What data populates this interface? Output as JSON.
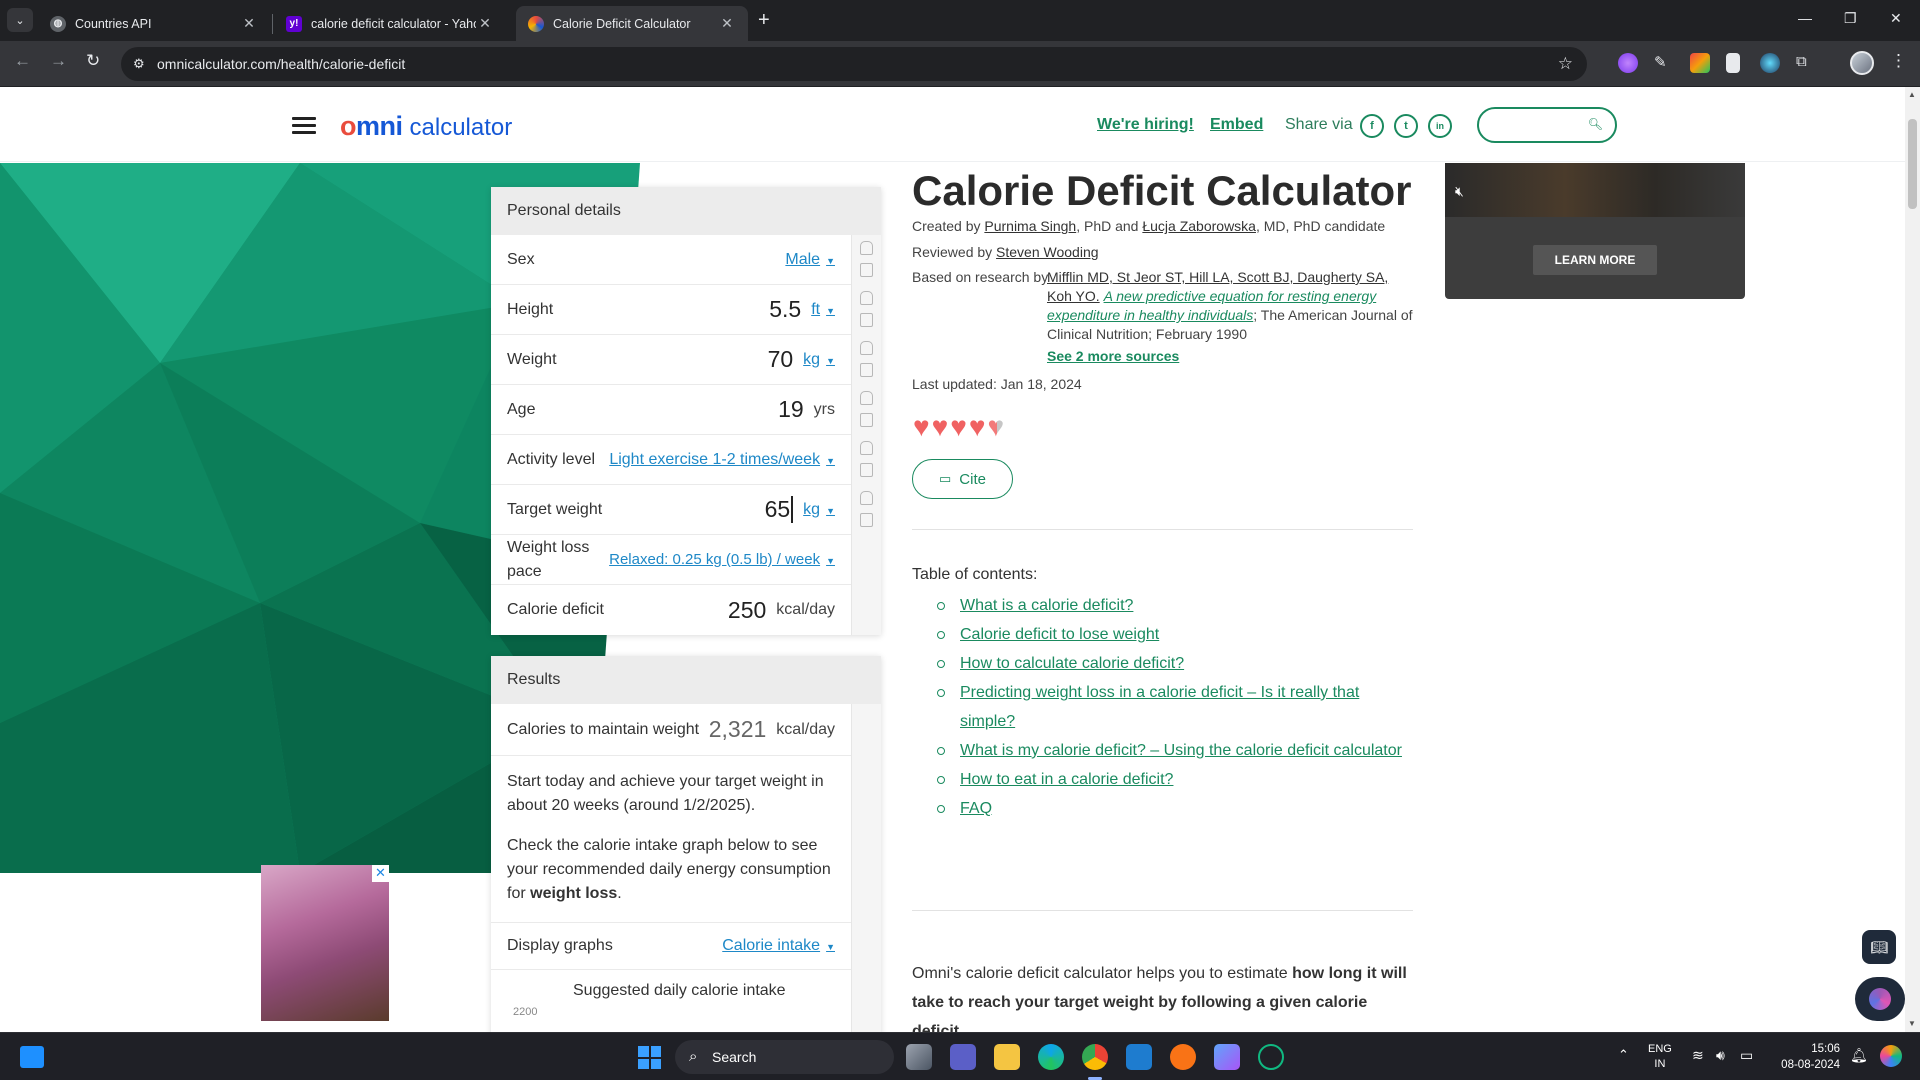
{
  "browser": {
    "tabs": [
      {
        "title": "Countries API",
        "active": false
      },
      {
        "title": "calorie deficit calculator - Yahoo",
        "active": false
      },
      {
        "title": "Calorie Deficit Calculator",
        "active": true
      }
    ],
    "new_tab": "+",
    "url": "omnicalculator.com/health/calorie-deficit"
  },
  "site": {
    "logo_omni": "mni",
    "logo_omni_o": "o",
    "logo_calc": "calculator",
    "hiring": "We're hiring!",
    "embed": "Embed",
    "share_via": "Share via",
    "social": {
      "facebook": "f",
      "twitter": "t",
      "linkedin": "in"
    }
  },
  "calculator": {
    "personal_header": "Personal details",
    "sex": {
      "label": "Sex",
      "value": "Male"
    },
    "height": {
      "label": "Height",
      "value": "5.5",
      "unit": "ft"
    },
    "weight": {
      "label": "Weight",
      "value": "70",
      "unit": "kg"
    },
    "age": {
      "label": "Age",
      "value": "19",
      "unit": "yrs"
    },
    "activity": {
      "label": "Activity level",
      "value": "Light exercise 1-2 times/week"
    },
    "target_weight": {
      "label": "Target weight",
      "value": "65",
      "unit": "kg"
    },
    "pace": {
      "label_line1": "Weight loss",
      "label_line2": "pace",
      "value": "Relaxed: 0.25 kg (0.5 lb) / week"
    },
    "deficit": {
      "label": "Calorie deficit",
      "value": "250",
      "unit": "kcal/day"
    },
    "results_header": "Results",
    "maintain": {
      "label": "Calories to maintain weight",
      "value": "2,321",
      "unit": "kcal/day"
    },
    "result_text_1": "Start today and achieve your target weight in about 20 weeks (around 1/2/2025).",
    "result_text_2_pre": "Check the calorie intake graph below to see your recommended daily energy consumption for",
    "result_text_2_bold": "weight loss",
    "result_text_2_post": ".",
    "display_graphs": {
      "label": "Display graphs",
      "value": "Calorie intake"
    },
    "graph_title": "Suggested daily calorie intake",
    "graph_tick": "2200"
  },
  "article": {
    "title": "Calorie Deficit Calculator",
    "created_prefix": "Created by",
    "author1": "Purnima Singh",
    "author1_suffix": ", PhD and",
    "author2": "Łucja Zaborowska",
    "author2_suffix": ", MD, PhD candidate",
    "reviewed_prefix": "Reviewed by",
    "reviewer": "Steven Wooding",
    "based_prefix": "Based on research by",
    "research_authors_1": "Mifflin MD, St Jeor ST, Hill LA, Scott BJ, Daugherty SA,",
    "research_authors_2": "Koh YO.",
    "research_title_1": "A new predictive equation for resting energy",
    "research_title_2": "expenditure in healthy individuals",
    "research_journal_1": "; The American Journal of",
    "research_journal_2": "Clinical Nutrition; February 1990",
    "see_more": "See 2 more sources",
    "last_updated": "Last updated: Jan 18, 2024",
    "rating_filled": 4.5,
    "cite": "Cite",
    "toc_title": "Table of contents:",
    "toc": [
      "What is a calorie deficit?",
      "Calorie deficit to lose weight",
      "How to calculate calorie deficit?",
      "Predicting weight loss in a calorie deficit – Is it really that simple?",
      "What is my calorie deficit? – Using the calorie deficit calculator",
      "How to eat in a calorie deficit?",
      "FAQ"
    ],
    "intro_pre": "Omni's calorie deficit calculator helps you to estimate",
    "intro_bold": "how long it will take to reach your target weight by following a given calorie deficit"
  },
  "ads": {
    "learn_more": "LEARN MORE",
    "close": "✕"
  },
  "taskbar": {
    "search": "Search",
    "lang_1": "ENG",
    "lang_2": "IN",
    "time": "15:06",
    "date": "08-08-2024"
  }
}
